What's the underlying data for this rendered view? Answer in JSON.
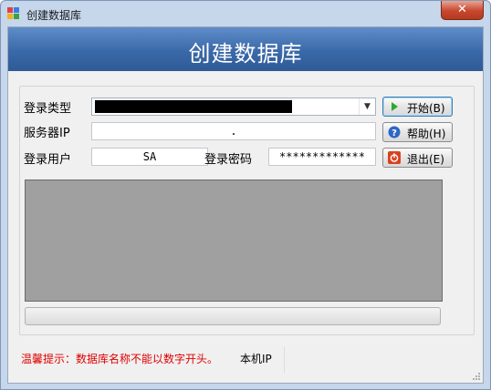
{
  "window": {
    "title": "创建数据库",
    "close_glyph": "✕"
  },
  "banner": {
    "title": "创建数据库"
  },
  "form": {
    "login_type_label": "登录类型",
    "server_ip_label": "服务器IP",
    "server_ip_value": ".",
    "login_user_label": "登录用户",
    "login_user_value": "SA",
    "login_password_label": "登录密码",
    "login_password_value": "*************"
  },
  "buttons": {
    "start": "开始(B)",
    "help": "帮助(H)",
    "exit": "退出(E)"
  },
  "progress": {
    "value": 0.0
  },
  "footer": {
    "tip": "温馨提示：数据库名称不能以数字开头。",
    "local_ip_label": "本机IP",
    "local_ip_value": ""
  },
  "colors": {
    "banner": "#3a69a9",
    "tip_text": "#e00000",
    "log_area": "#a0a0a0",
    "close_button": "#c7472e"
  },
  "icons": {
    "app": "window-app-icon",
    "start": "play-icon",
    "help": "help-icon",
    "exit": "power-icon",
    "dropdown": "chevron-down-icon"
  }
}
